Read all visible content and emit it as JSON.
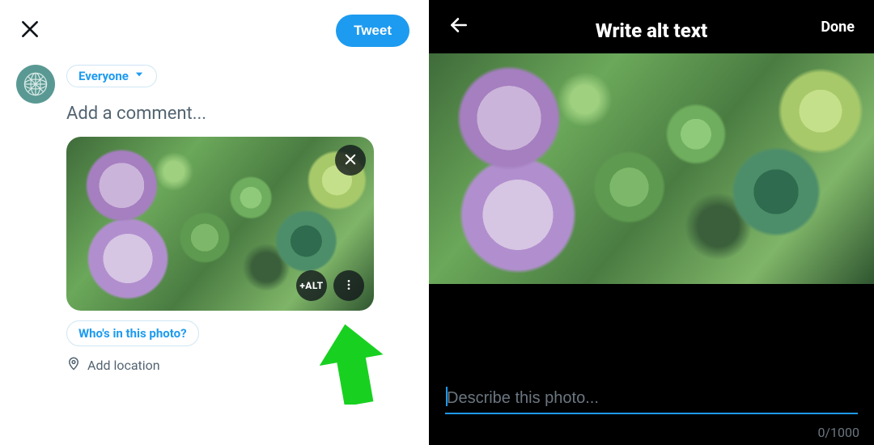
{
  "left": {
    "tweet_button": "Tweet",
    "audience_label": "Everyone",
    "comment_placeholder": "Add a comment...",
    "media": {
      "alt_button_label": "+ALT"
    },
    "tag_people_label": "Who's in this photo?",
    "add_location_label": "Add location"
  },
  "right": {
    "title": "Write alt text",
    "done_label": "Done",
    "input_placeholder": "Describe this photo...",
    "input_value": "",
    "counter": "0/1000"
  }
}
